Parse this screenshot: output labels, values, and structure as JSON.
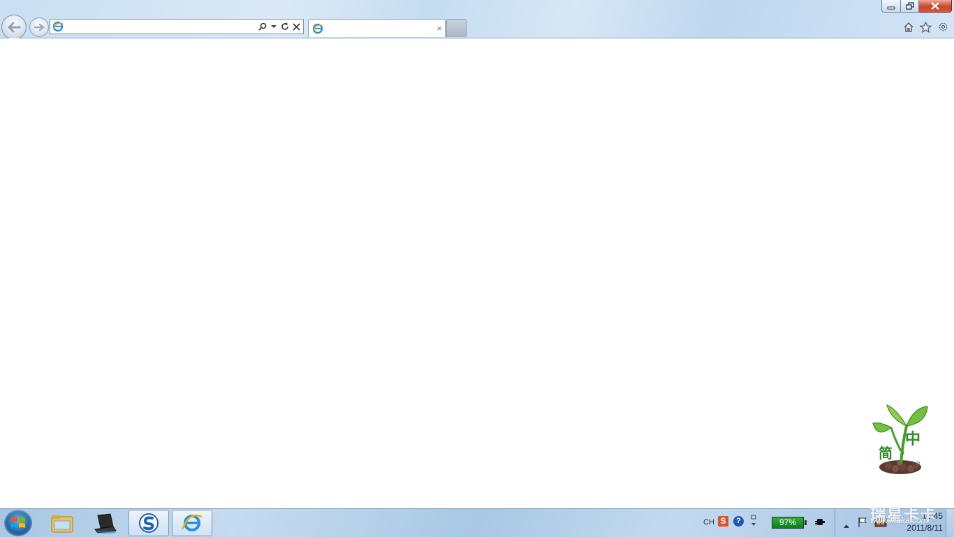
{
  "window": {
    "minimize_icon": "minimize-icon",
    "restore_icon": "restore-icon",
    "close_icon": "close-icon"
  },
  "nav": {
    "back_icon": "back-arrow-icon",
    "forward_icon": "forward-arrow-icon"
  },
  "address_bar": {
    "value": "",
    "placeholder": "",
    "tools": [
      "search-icon",
      "dropdown-icon",
      "refresh-icon",
      "stop-icon"
    ]
  },
  "tabs": [
    {
      "title": "",
      "close_symbol": "×"
    }
  ],
  "toolbar_right": [
    "home-icon",
    "favorites-star-icon",
    "settings-gear-icon"
  ],
  "desktop_widget": {
    "char_jian": "简",
    "char_zhong": "中",
    "comma": "，",
    "period": "。"
  },
  "taskbar": {
    "pinned": [
      "windows-explorer-icon",
      "laptop-icon",
      "sogou-browser-icon",
      "internet-explorer-icon"
    ],
    "active_index": 3,
    "tray": {
      "language": "CH",
      "ime_badge": "S",
      "help_symbol": "?",
      "battery_percent": "97%",
      "clock_time": "15:45",
      "clock_date": "2011/8/11"
    }
  },
  "watermark": {
    "site_cn": "瑞星卡卡",
    "site_url": "www.ikaka.com"
  },
  "colors": {
    "chrome_blue": "#c9dff2",
    "close_red": "#c7452d",
    "battery_green": "#2fae3c",
    "sprout_green": "#2f8a2a"
  }
}
